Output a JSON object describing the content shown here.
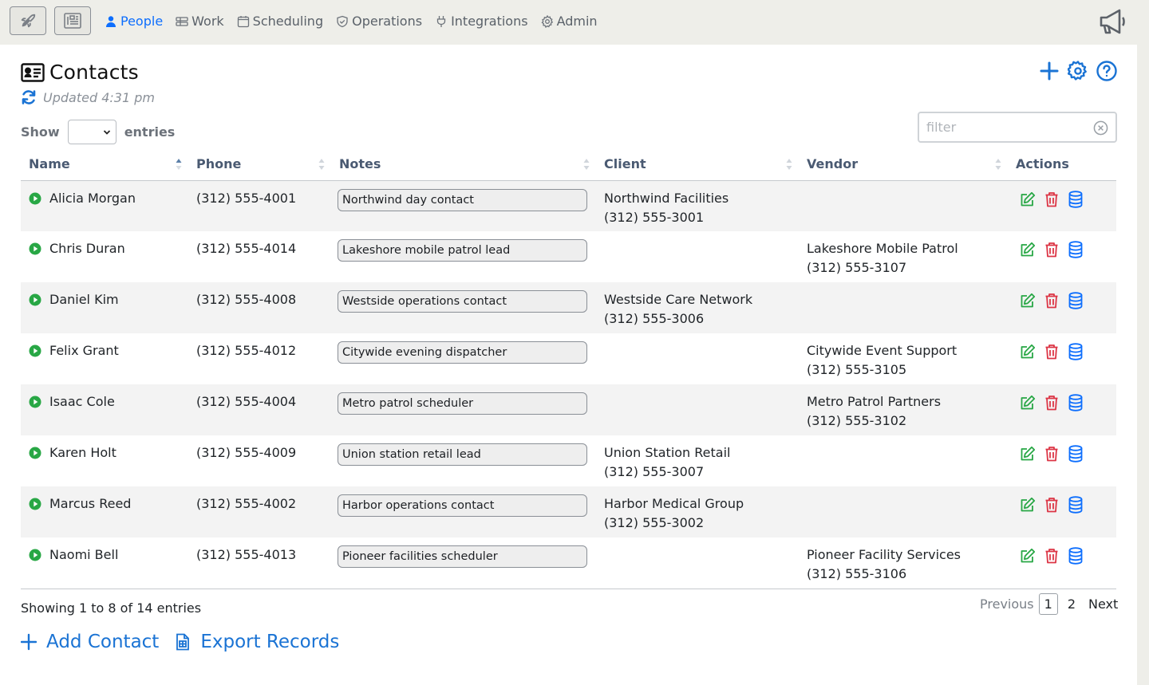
{
  "nav": {
    "items": [
      {
        "label": "People",
        "icon": "person-icon",
        "active": true
      },
      {
        "label": "Work",
        "icon": "grid-icon",
        "active": false
      },
      {
        "label": "Scheduling",
        "icon": "calendar-icon",
        "active": false
      },
      {
        "label": "Operations",
        "icon": "shield-icon",
        "active": false
      },
      {
        "label": "Integrations",
        "icon": "plug-icon",
        "active": false
      },
      {
        "label": "Admin",
        "icon": "gear-icon",
        "active": false
      }
    ]
  },
  "page": {
    "title": "Contacts",
    "updated": "Updated 4:31 pm"
  },
  "controls": {
    "show_label": "Show",
    "entries_label": "entries",
    "entries_value": "",
    "filter_placeholder": "filter"
  },
  "table": {
    "columns": [
      "Name",
      "Phone",
      "Notes",
      "Client",
      "Vendor",
      "Actions"
    ],
    "sorted_column": "Name",
    "rows": [
      {
        "name": "Alicia Morgan",
        "phone": "(312) 555-4001",
        "note": "Northwind day contact",
        "client": "Northwind Facilities",
        "client_phone": "(312) 555-3001",
        "vendor": "",
        "vendor_phone": ""
      },
      {
        "name": "Chris Duran",
        "phone": "(312) 555-4014",
        "note": "Lakeshore mobile patrol lead",
        "client": "",
        "client_phone": "",
        "vendor": "Lakeshore Mobile Patrol",
        "vendor_phone": "(312) 555-3107"
      },
      {
        "name": "Daniel Kim",
        "phone": "(312) 555-4008",
        "note": "Westside operations contact",
        "client": "Westside Care Network",
        "client_phone": "(312) 555-3006",
        "vendor": "",
        "vendor_phone": ""
      },
      {
        "name": "Felix Grant",
        "phone": "(312) 555-4012",
        "note": "Citywide evening dispatcher",
        "client": "",
        "client_phone": "",
        "vendor": "Citywide Event Support",
        "vendor_phone": "(312) 555-3105"
      },
      {
        "name": "Isaac Cole",
        "phone": "(312) 555-4004",
        "note": "Metro patrol scheduler",
        "client": "",
        "client_phone": "",
        "vendor": "Metro Patrol Partners",
        "vendor_phone": "(312) 555-3102"
      },
      {
        "name": "Karen Holt",
        "phone": "(312) 555-4009",
        "note": "Union station retail lead",
        "client": "Union Station Retail",
        "client_phone": "(312) 555-3007",
        "vendor": "",
        "vendor_phone": ""
      },
      {
        "name": "Marcus Reed",
        "phone": "(312) 555-4002",
        "note": "Harbor operations contact",
        "client": "Harbor Medical Group",
        "client_phone": "(312) 555-3002",
        "vendor": "",
        "vendor_phone": ""
      },
      {
        "name": "Naomi Bell",
        "phone": "(312) 555-4013",
        "note": "Pioneer facilities scheduler",
        "client": "",
        "client_phone": "",
        "vendor": "Pioneer Facility Services",
        "vendor_phone": "(312) 555-3106"
      }
    ]
  },
  "footer": {
    "showing": "Showing 1 to 8 of 14 entries",
    "pager": {
      "previous": "Previous",
      "pages": [
        "1",
        "2"
      ],
      "current": "1",
      "next": "Next"
    },
    "add_contact": "Add Contact",
    "export_records": "Export Records"
  },
  "colors": {
    "accent": "#0d6efd",
    "link": "#1a73d4",
    "active_status": "#28a745",
    "edit": "#28a745",
    "delete": "#dc3545",
    "database": "#0d6efd"
  }
}
